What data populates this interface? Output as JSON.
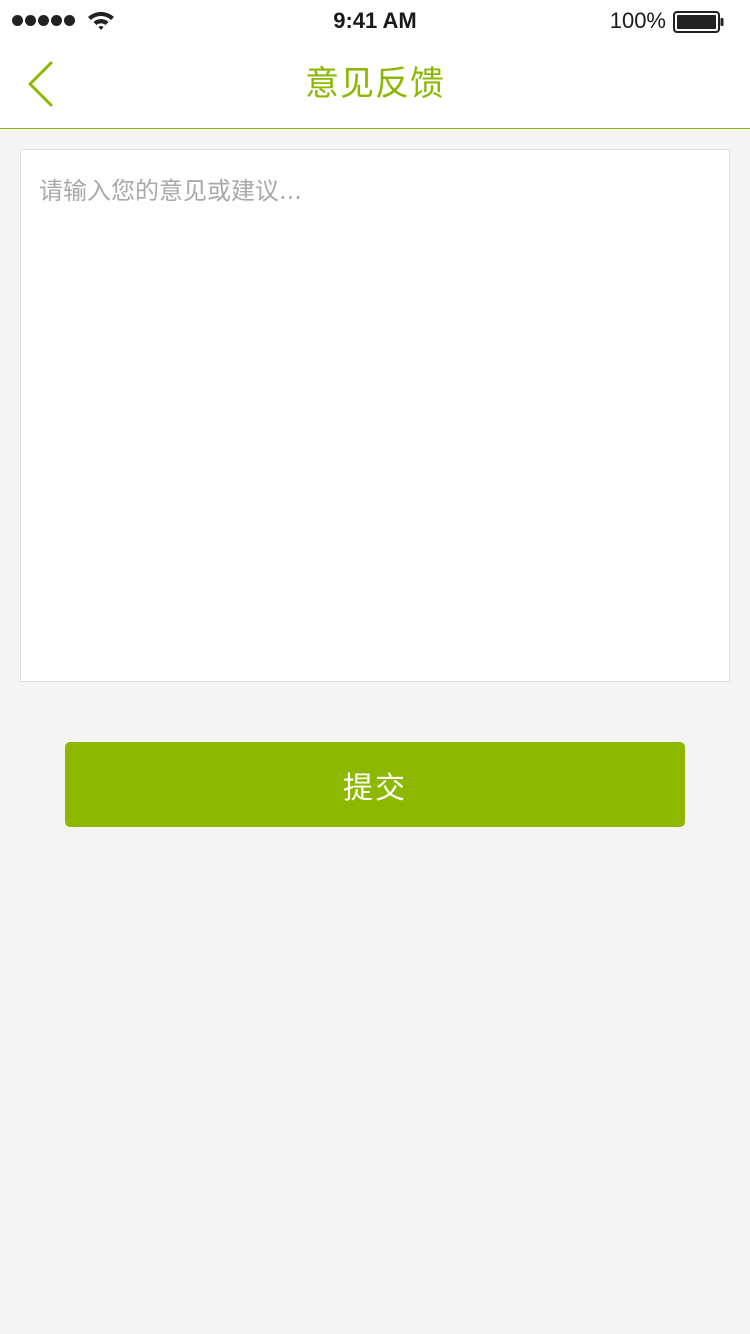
{
  "status_bar": {
    "time": "9:41 AM",
    "battery": "100%",
    "signal_icon": "signal-dots-icon",
    "wifi_icon": "wifi-icon",
    "battery_icon": "battery-full-icon"
  },
  "nav": {
    "back_icon": "chevron-left-icon",
    "title": "意见反馈"
  },
  "feedback": {
    "value": "",
    "placeholder": "请输入您的意见或建议..."
  },
  "submit": {
    "label": "提交"
  },
  "colors": {
    "accent": "#8db800",
    "background": "#f4f4f4",
    "surface": "#ffffff",
    "placeholder": "#a9a9a9"
  }
}
